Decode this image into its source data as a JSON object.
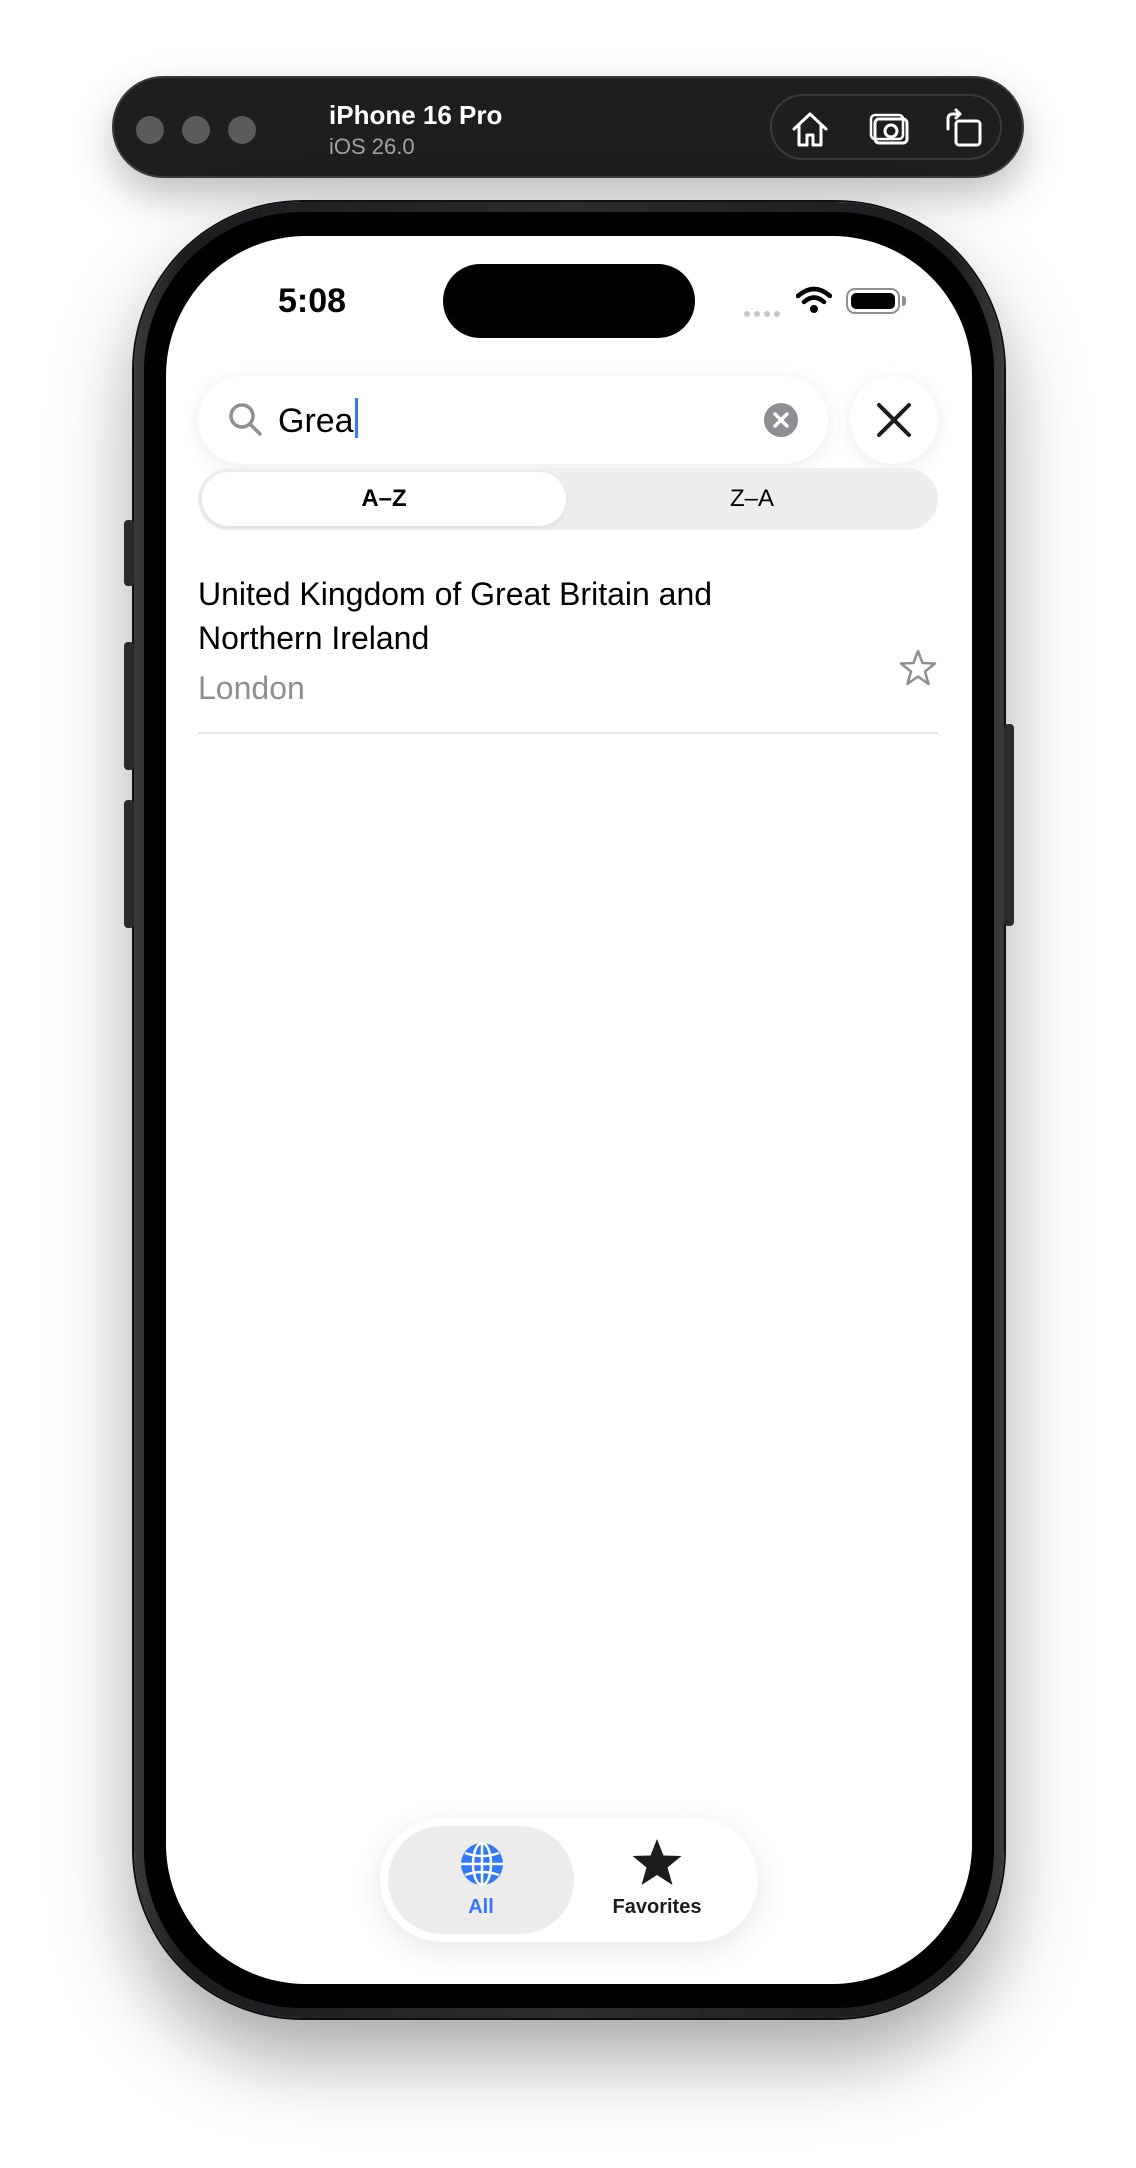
{
  "simulator": {
    "device_name": "iPhone 16 Pro",
    "os_version": "iOS 26.0",
    "actions": [
      "home-icon",
      "screenshot-icon",
      "rotate-icon"
    ]
  },
  "status_bar": {
    "time": "5:08"
  },
  "search": {
    "value": "Grea"
  },
  "sort": {
    "options": [
      "A–Z",
      "Z–A"
    ],
    "selected": "A–Z"
  },
  "results": [
    {
      "name": "United Kingdom of Great Britain and Northern Ireland",
      "capital": "London",
      "favorite": false
    }
  ],
  "tabbar": {
    "tabs": [
      {
        "label": "All",
        "icon": "globe-icon",
        "selected": true
      },
      {
        "label": "Favorites",
        "icon": "star-fill-icon",
        "selected": false
      }
    ]
  },
  "colors": {
    "accent": "#3478f6",
    "secondary_text": "#8e8e93"
  }
}
